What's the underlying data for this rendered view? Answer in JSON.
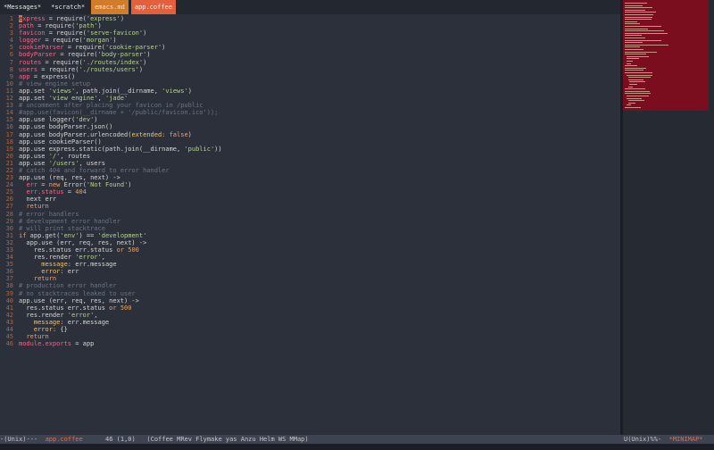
{
  "tabs": [
    {
      "label": "*Messages*",
      "kind": "normal"
    },
    {
      "label": "*scratch*",
      "kind": "normal"
    },
    {
      "label": "emacs.md",
      "kind": "md"
    },
    {
      "label": "app.coffee",
      "kind": "active"
    }
  ],
  "lines": [
    {
      "n": "1",
      "seg": [
        [
          "cursor",
          "e"
        ],
        [
          "var",
          "xpress"
        ],
        [
          "def",
          " = require("
        ],
        [
          "str",
          "'express'"
        ],
        [
          "def",
          ")"
        ]
      ]
    },
    {
      "n": "2",
      "seg": [
        [
          "var",
          "path"
        ],
        [
          "def",
          " = require("
        ],
        [
          "str",
          "'path'"
        ],
        [
          "def",
          ")"
        ]
      ]
    },
    {
      "n": "3",
      "seg": [
        [
          "var",
          "favicon"
        ],
        [
          "def",
          " = require("
        ],
        [
          "str",
          "'serve-favicon'"
        ],
        [
          "def",
          ")"
        ]
      ]
    },
    {
      "n": "4",
      "seg": [
        [
          "var",
          "logger"
        ],
        [
          "def",
          " = require("
        ],
        [
          "str",
          "'morgan'"
        ],
        [
          "def",
          ")"
        ]
      ]
    },
    {
      "n": "5",
      "seg": [
        [
          "var",
          "cookieParser"
        ],
        [
          "def",
          " = require("
        ],
        [
          "str",
          "'cookie-parser'"
        ],
        [
          "def",
          ")"
        ]
      ]
    },
    {
      "n": "6",
      "seg": [
        [
          "var",
          "bodyParser"
        ],
        [
          "def",
          " = require("
        ],
        [
          "str",
          "'body-parser'"
        ],
        [
          "def",
          ")"
        ]
      ]
    },
    {
      "n": "7",
      "seg": [
        [
          "var",
          "routes"
        ],
        [
          "def",
          " = require("
        ],
        [
          "str",
          "'./routes/index'"
        ],
        [
          "def",
          ")"
        ]
      ]
    },
    {
      "n": "8",
      "seg": [
        [
          "var",
          "users"
        ],
        [
          "def",
          " = require("
        ],
        [
          "str",
          "'./routes/users'"
        ],
        [
          "def",
          ")"
        ]
      ]
    },
    {
      "n": "9",
      "seg": [
        [
          "var",
          "app"
        ],
        [
          "def",
          " = express()"
        ]
      ]
    },
    {
      "n": "10",
      "seg": [
        [
          "com",
          "# view engine setup"
        ]
      ]
    },
    {
      "n": "11",
      "seg": [
        [
          "def",
          "app.set "
        ],
        [
          "str",
          "'views'"
        ],
        [
          "def",
          ", path.join(__dirname, "
        ],
        [
          "str",
          "'views'"
        ],
        [
          "def",
          ")"
        ]
      ]
    },
    {
      "n": "12",
      "seg": [
        [
          "def",
          "app.set "
        ],
        [
          "str",
          "'view engine'"
        ],
        [
          "def",
          ", "
        ],
        [
          "str",
          "'jade'"
        ]
      ]
    },
    {
      "n": "13",
      "seg": [
        [
          "com",
          "# uncomment after placing your favicon in /public"
        ]
      ]
    },
    {
      "n": "14",
      "seg": [
        [
          "com",
          "#app.use(favicon(__dirname + '/public/favicon.ico'));"
        ]
      ]
    },
    {
      "n": "15",
      "seg": [
        [
          "def",
          "app.use logger("
        ],
        [
          "str",
          "'dev'"
        ],
        [
          "def",
          ")"
        ]
      ]
    },
    {
      "n": "16",
      "seg": [
        [
          "def",
          "app.use bodyParser.json()"
        ]
      ]
    },
    {
      "n": "17",
      "seg": [
        [
          "def",
          "app.use bodyParser.urlencoded("
        ],
        [
          "prop",
          "extended:"
        ],
        [
          "def",
          " "
        ],
        [
          "kw",
          "false"
        ],
        [
          "def",
          ")"
        ]
      ]
    },
    {
      "n": "18",
      "seg": [
        [
          "def",
          "app.use cookieParser()"
        ]
      ]
    },
    {
      "n": "19",
      "seg": [
        [
          "def",
          "app.use express.static(path.join(__dirname, "
        ],
        [
          "str",
          "'public'"
        ],
        [
          "def",
          "))"
        ]
      ]
    },
    {
      "n": "20",
      "seg": [
        [
          "def",
          "app.use "
        ],
        [
          "str",
          "'/'"
        ],
        [
          "def",
          ", routes"
        ]
      ]
    },
    {
      "n": "21",
      "seg": [
        [
          "def",
          "app.use "
        ],
        [
          "str",
          "'/users'"
        ],
        [
          "def",
          ", users"
        ]
      ]
    },
    {
      "n": "22",
      "seg": [
        [
          "com",
          "# catch 404 and forward to error handler"
        ]
      ]
    },
    {
      "n": "23",
      "seg": [
        [
          "def",
          "app.use (req, res, next) ->"
        ]
      ]
    },
    {
      "n": "24",
      "seg": [
        [
          "def",
          "  "
        ],
        [
          "var",
          "err"
        ],
        [
          "def",
          " = "
        ],
        [
          "kw",
          "new"
        ],
        [
          "def",
          " Error("
        ],
        [
          "str",
          "'Not Found'"
        ],
        [
          "def",
          ")"
        ]
      ]
    },
    {
      "n": "25",
      "seg": [
        [
          "def",
          "  "
        ],
        [
          "var",
          "err.status"
        ],
        [
          "def",
          " = "
        ],
        [
          "num",
          "404"
        ]
      ]
    },
    {
      "n": "26",
      "seg": [
        [
          "def",
          "  next err"
        ]
      ]
    },
    {
      "n": "27",
      "seg": [
        [
          "def",
          "  "
        ],
        [
          "kw",
          "return"
        ]
      ]
    },
    {
      "n": "28",
      "seg": [
        [
          "com",
          "# error handlers"
        ]
      ]
    },
    {
      "n": "29",
      "seg": [
        [
          "com",
          "# development error handler"
        ]
      ]
    },
    {
      "n": "30",
      "seg": [
        [
          "com",
          "# will print stacktrace"
        ]
      ]
    },
    {
      "n": "31",
      "seg": [
        [
          "kw",
          "if"
        ],
        [
          "def",
          " app.get("
        ],
        [
          "str",
          "'env'"
        ],
        [
          "def",
          ") == "
        ],
        [
          "str",
          "'development'"
        ]
      ]
    },
    {
      "n": "32",
      "seg": [
        [
          "def",
          "  app.use (err, req, res, next) ->"
        ]
      ]
    },
    {
      "n": "33",
      "seg": [
        [
          "def",
          "    res.status err.status "
        ],
        [
          "kw",
          "or"
        ],
        [
          "def",
          " "
        ],
        [
          "num",
          "500"
        ]
      ]
    },
    {
      "n": "34",
      "seg": [
        [
          "def",
          "    res.render "
        ],
        [
          "str",
          "'error'"
        ],
        [
          "def",
          ","
        ]
      ]
    },
    {
      "n": "35",
      "seg": [
        [
          "def",
          "      "
        ],
        [
          "prop",
          "message:"
        ],
        [
          "def",
          " err.message"
        ]
      ]
    },
    {
      "n": "36",
      "seg": [
        [
          "def",
          "      "
        ],
        [
          "prop",
          "error:"
        ],
        [
          "def",
          " err"
        ]
      ]
    },
    {
      "n": "37",
      "seg": [
        [
          "def",
          "    "
        ],
        [
          "kw",
          "return"
        ]
      ]
    },
    {
      "n": "38",
      "seg": [
        [
          "com",
          "# production error handler"
        ]
      ]
    },
    {
      "n": "39",
      "seg": [
        [
          "com",
          "# no stacktraces leaked to user"
        ]
      ]
    },
    {
      "n": "40",
      "seg": [
        [
          "def",
          "app.use (err, req, res, next) ->"
        ]
      ]
    },
    {
      "n": "41",
      "seg": [
        [
          "def",
          "  res.status err.status "
        ],
        [
          "kw",
          "or"
        ],
        [
          "def",
          " "
        ],
        [
          "num",
          "500"
        ]
      ]
    },
    {
      "n": "42",
      "seg": [
        [
          "def",
          "  res.render "
        ],
        [
          "str",
          "'error'"
        ],
        [
          "def",
          ","
        ]
      ]
    },
    {
      "n": "43",
      "seg": [
        [
          "def",
          "    "
        ],
        [
          "prop",
          "message:"
        ],
        [
          "def",
          " err.message"
        ]
      ]
    },
    {
      "n": "44",
      "seg": [
        [
          "def",
          "    "
        ],
        [
          "prop",
          "error:"
        ],
        [
          "def",
          " {}"
        ]
      ]
    },
    {
      "n": "45",
      "seg": [
        [
          "def",
          "  "
        ],
        [
          "kw",
          "return"
        ]
      ]
    },
    {
      "n": "46",
      "seg": [
        [
          "var",
          "module.exports"
        ],
        [
          "def",
          " = app"
        ]
      ]
    }
  ],
  "modeline": {
    "encoding": "-(Unix)---  ",
    "buffer": "app.coffee",
    "position": "      46 (1,0)   ",
    "modes": "(Coffee MRev Flymake yas Anzu Helm WS MMap)",
    "right_encoding": "U(Unix)%%-  ",
    "right_buffer": "*MINIMAP*"
  },
  "colors": {
    "background": "#2b303b",
    "minimap_viewport": "#7a0d1e",
    "active_tab": "#e2603c",
    "md_tab": "#d27c2a"
  }
}
